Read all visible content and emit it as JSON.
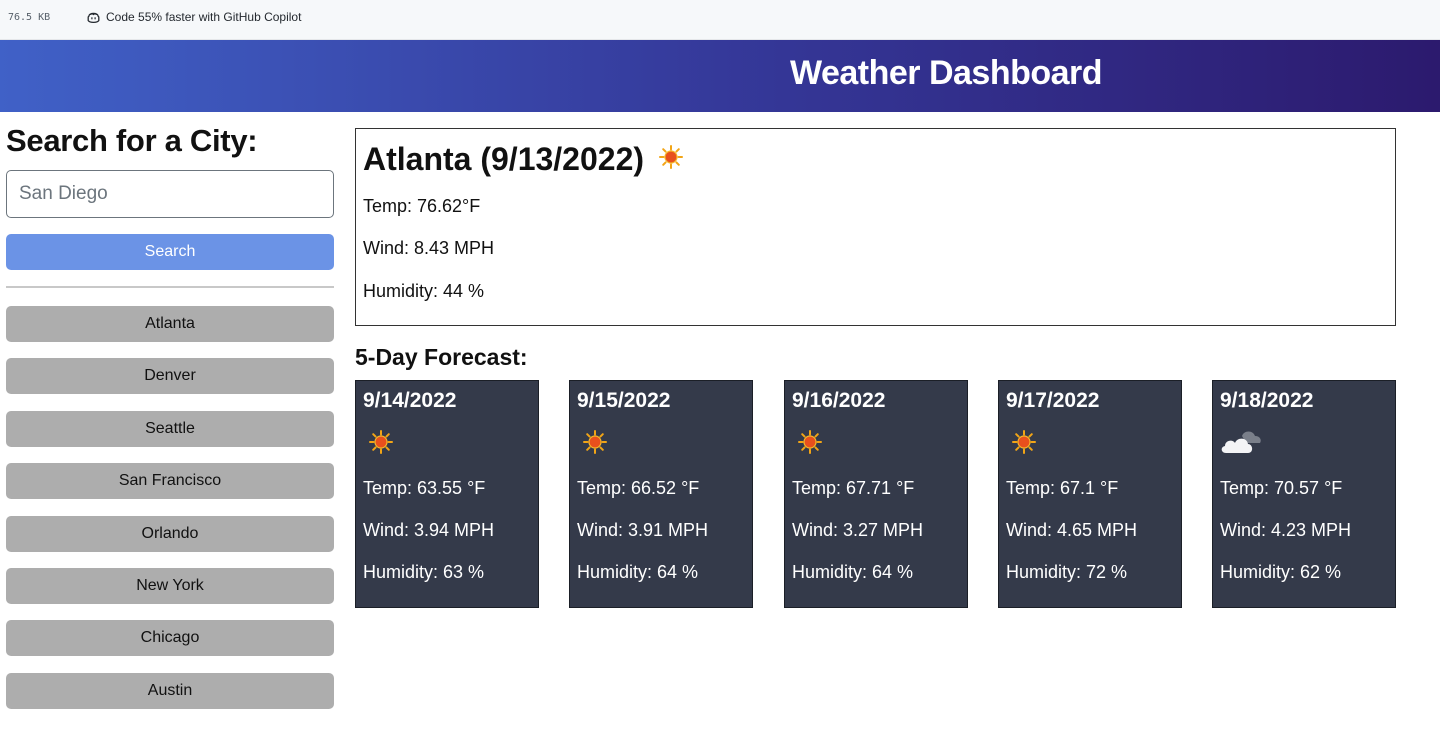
{
  "browser": {
    "file_size": "76.5 KB",
    "promo_text": "Code 55% faster with GitHub Copilot"
  },
  "header": {
    "title": "Weather Dashboard"
  },
  "sidebar": {
    "heading": "Search for a City:",
    "search_value": "San Diego",
    "search_button": "Search",
    "history": [
      "Atlanta",
      "Denver",
      "Seattle",
      "San Francisco",
      "Orlando",
      "New York",
      "Chicago",
      "Austin"
    ]
  },
  "current": {
    "city_date": "Atlanta (9/13/2022)",
    "icon": "sun-icon",
    "temp": "Temp: 76.62°F",
    "wind": "Wind: 8.43 MPH",
    "humidity": "Humidity: 44 %"
  },
  "forecast": {
    "title": "5-Day Forecast:",
    "days": [
      {
        "date": "9/14/2022",
        "icon": "sun-icon",
        "temp": "Temp: 63.55 °F",
        "wind": "Wind: 3.94 MPH",
        "humidity": "Humidity: 63 %"
      },
      {
        "date": "9/15/2022",
        "icon": "sun-icon",
        "temp": "Temp: 66.52 °F",
        "wind": "Wind: 3.91 MPH",
        "humidity": "Humidity: 64 %"
      },
      {
        "date": "9/16/2022",
        "icon": "sun-icon",
        "temp": "Temp: 67.71 °F",
        "wind": "Wind: 3.27 MPH",
        "humidity": "Humidity: 64 %"
      },
      {
        "date": "9/17/2022",
        "icon": "sun-icon",
        "temp": "Temp: 67.1 °F",
        "wind": "Wind: 4.65 MPH",
        "humidity": "Humidity: 72 %"
      },
      {
        "date": "9/18/2022",
        "icon": "cloud-icon",
        "temp": "Temp: 70.57 °F",
        "wind": "Wind: 4.23 MPH",
        "humidity": "Humidity: 62 %"
      }
    ]
  }
}
